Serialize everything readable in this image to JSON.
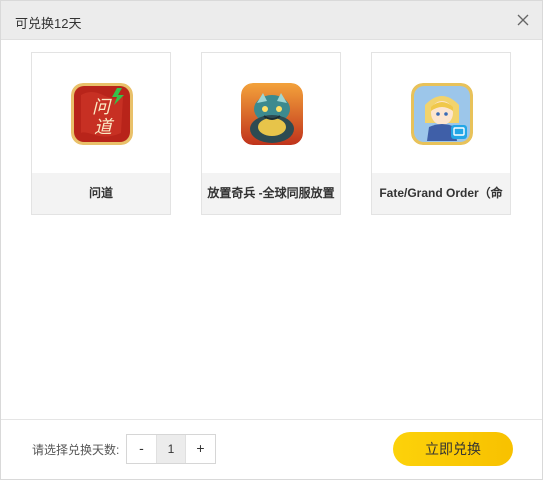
{
  "dialog": {
    "title": "可兑换12天",
    "close_icon": "close-icon"
  },
  "games": [
    {
      "name": "问道",
      "icon": "wendao-game-icon",
      "icon_text": "问道"
    },
    {
      "name": "放置奇兵 -全球同服放置",
      "icon": "idle-heroes-game-icon"
    },
    {
      "name": "Fate/Grand Order（命",
      "icon": "fate-grand-order-game-icon"
    }
  ],
  "footer": {
    "days_label": "请选择兑换天数:",
    "decrement_label": "-",
    "quantity": "1",
    "increment_label": "+",
    "redeem_label": "立即兑换"
  },
  "colors": {
    "accent": "#fcd20a",
    "titlebar": "#ececec"
  }
}
